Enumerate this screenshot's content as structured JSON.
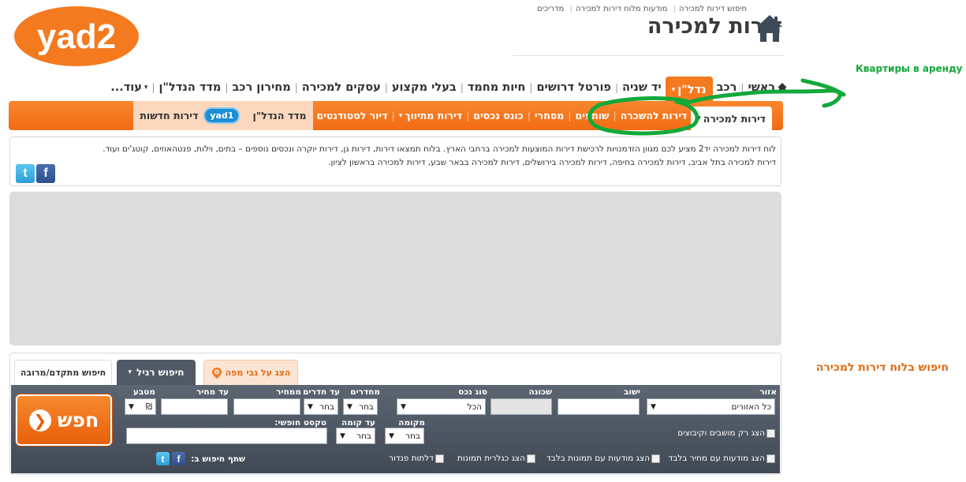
{
  "logo": {
    "text": "yad2"
  },
  "top_links": [
    "חיפוש דירות למכירה",
    "מודעות מלוח דירות למכירה",
    "מדריכים"
  ],
  "page_title": "דירות למכירה",
  "main_nav": {
    "items": [
      "ראשי",
      "רכב",
      "נדל\"ן",
      "יד שניה",
      "פורטל דרושים",
      "חיות מחמד",
      "בעלי מקצוע",
      "עסקים למכירה",
      "מחירון רכב",
      "מדד הנדל\"ן",
      "עוד..."
    ],
    "active_index": 2
  },
  "sub_nav": {
    "items": [
      "דירות למכירה",
      "דירות להשכרה",
      "שותפים",
      "מסחרי",
      "כונס נכסים",
      "דירות מתיווך",
      "דיור לסטודנטים",
      "מדד הנדל\"ן",
      "דירות חדשות"
    ],
    "yad1_badge": "yad1"
  },
  "info": {
    "line1": "לוח דירות למכירה יד2 מציע לכם מגוון הזדמנויות לרכישת דירות המוצעות למכירה ברחבי הארץ. בלוח תמצאו דירות, דירות גן, דירות יוקרה ונכסים נוספים – בתים, וילות, פנטהאוזים, קוטג'ים ועוד.",
    "line2": "דירות למכירה בתל אביב, דירות למכירה בחיפה, דירות למכירה בירושלים, דירות למכירה בבאר שבע, דירות למכירה בראשון לציון."
  },
  "search": {
    "title": "חיפוש בלוח דירות למכירה",
    "tabs": {
      "map": "הצג על גבי מפה",
      "regular": "חיפוש רגיל",
      "advanced": "חיפוש מתקדם/מרובה"
    },
    "labels": {
      "area": "אזור",
      "settlement": "ישוב",
      "neighborhood": "שכונה",
      "asset_type": "סוג נכס",
      "rooms_from": "מחדרים",
      "rooms_to": "עד חדרים",
      "price_from": "ממחיר",
      "price_to": "עד מחיר",
      "currency": "מטבע",
      "floor_from": "מקומה",
      "floor_to": "עד קומה",
      "free_text": "טקסט חופשי:"
    },
    "values": {
      "area": "כל האזורים",
      "asset_type": "הכל",
      "rooms_from": "בחר",
      "rooms_to": "בחר",
      "currency": "₪",
      "floor_from": "בחר",
      "floor_to": "בחר"
    },
    "checkboxes": {
      "settlements_only": "הצג רק מושבים וקיבוצים",
      "with_price": "הצג מודעות עם מחיר בלבד",
      "with_images": "הצג מודעות עם תמונות בלבד",
      "gallery": "הצג כגלרית תמונות",
      "parking": "דלתות פנדור"
    },
    "share_label": "שתף חיפוש ב:",
    "button": "חפש"
  },
  "annotation": {
    "text": "Квартиры в аренду",
    "color": "#13a83a"
  },
  "colors": {
    "orange": "#f47a20",
    "dark_bar": "#4b5460",
    "annotation": "#13a83a"
  }
}
